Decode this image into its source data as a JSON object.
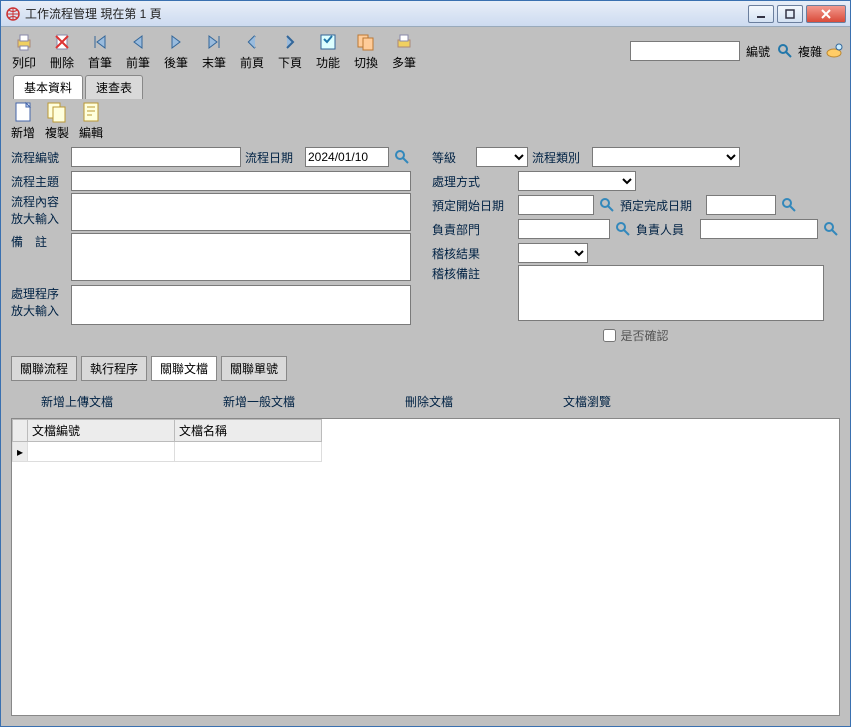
{
  "window": {
    "title": "工作流程管理  現在第 1 頁"
  },
  "toolbar": {
    "print": "列印",
    "delete": "刪除",
    "first": "首筆",
    "prev": "前筆",
    "next": "後筆",
    "last": "末筆",
    "prevPage": "前頁",
    "nextPage": "下頁",
    "functions": "功能",
    "switch": "切換",
    "multi": "多筆",
    "numLabel": "編號",
    "complex": "複雜"
  },
  "mainTabs": {
    "basic": "基本資料",
    "quick": "速查表"
  },
  "innerToolbar": {
    "add": "新增",
    "copy": "複製",
    "edit": "編輯"
  },
  "form": {
    "labels": {
      "procNum": "流程編號",
      "procDate": "流程日期",
      "level": "等級",
      "procType": "流程類別",
      "procSubject": "流程主題",
      "handleMethod": "處理方式",
      "procContent": "流程內容",
      "zoomInput1": "放大輸入",
      "plannedStart": "預定開始日期",
      "plannedEnd": "預定完成日期",
      "respDept": "負責部門",
      "respPerson": "負責人員",
      "remark": "備　註",
      "auditResult": "稽核結果",
      "auditRemark": "稽核備註",
      "procProgram": "處理程序",
      "zoomInput2": "放大輸入",
      "confirm": "是否確認"
    },
    "values": {
      "procDate": "2024/01/10"
    }
  },
  "subTabs": {
    "relatedProc": "關聯流程",
    "execProc": "執行程序",
    "relatedDoc": "關聯文檔",
    "relatedOrder": "關聯單號"
  },
  "subActions": {
    "uploadDoc": "新增上傳文檔",
    "generalDoc": "新增一般文檔",
    "deleteDoc": "刪除文檔",
    "browseDoc": "文檔瀏覽"
  },
  "grid": {
    "headers": {
      "docNum": "文檔編號",
      "docName": "文檔名稱"
    }
  }
}
